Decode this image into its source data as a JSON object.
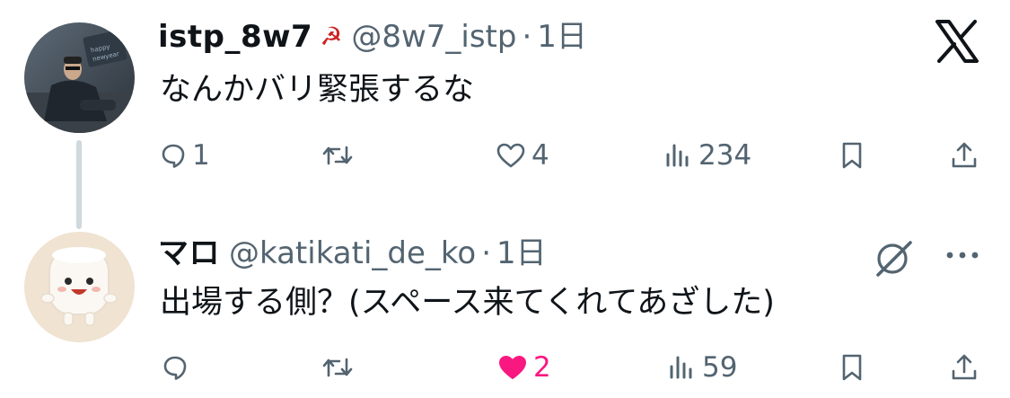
{
  "thread": [
    {
      "display_name": "istp_8w7",
      "name_emoji": "☭",
      "handle": "@8w7_istp",
      "separator": "·",
      "time": "1日",
      "text": "なんかバリ緊張するな",
      "avatar_icon": "avatar-happy-new-year",
      "actions": {
        "reply_count": "1",
        "repost_count": "",
        "like_count": "4",
        "views_count": "234"
      }
    },
    {
      "display_name": "マロ",
      "handle": "@katikati_de_ko",
      "separator": "·",
      "time": "1日",
      "text": "出場する側？(スペース来てくれてあざした)",
      "avatar_icon": "avatar-marshmallow",
      "actions": {
        "reply_count": "",
        "repost_count": "",
        "like_count": "2",
        "views_count": "59",
        "liked": true
      }
    }
  ],
  "icons": {
    "brand": "x-logo",
    "grok": "grok-icon",
    "more": "more-icon",
    "reply": "reply-icon",
    "repost": "repost-icon",
    "like": "heart-icon",
    "views": "views-icon",
    "bookmark": "bookmark-icon",
    "share": "share-icon"
  },
  "colors": {
    "text": "#0f1419",
    "muted": "#536471",
    "like": "#f91880",
    "thread_line": "#cfd9de"
  }
}
